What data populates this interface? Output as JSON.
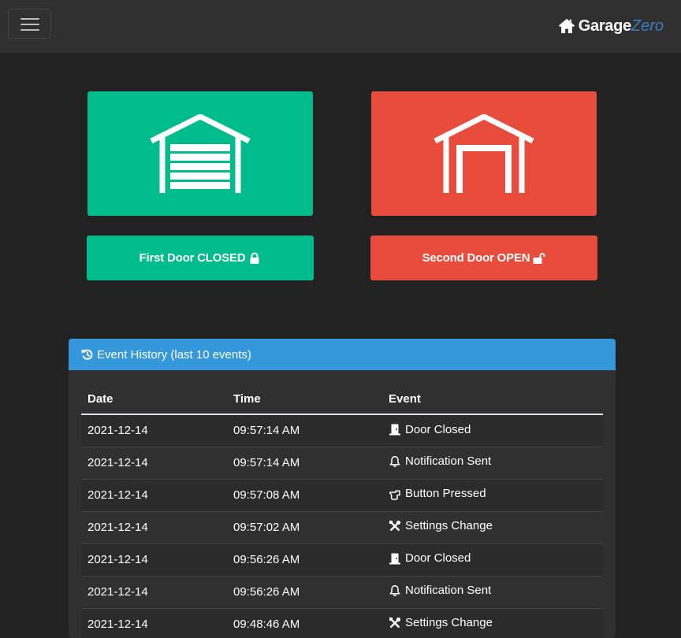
{
  "navbar": {
    "toggle_icon": "hamburger-menu-icon",
    "brand_icon": "home-icon",
    "brand_part1": "Garage",
    "brand_part2": "Zero",
    "brand_accent_color": "#3a7bc0"
  },
  "doors": [
    {
      "status": "CLOSED",
      "button_label": "First Door CLOSED",
      "card_icon": "garage-closed-icon",
      "status_icon": "lock-icon",
      "color": "#00bc8c"
    },
    {
      "status": "OPEN",
      "button_label": "Second Door OPEN",
      "card_icon": "garage-open-icon",
      "status_icon": "unlock-icon",
      "color": "#e74c3c"
    }
  ],
  "history": {
    "title": "Event History (last 10 events)",
    "title_icon": "history-icon",
    "header_color": "#3498db",
    "columns": [
      "Date",
      "Time",
      "Event"
    ],
    "rows": [
      {
        "date": "2021-12-14",
        "time": "09:57:14 AM",
        "event": "Door Closed",
        "icon": "door-closed-icon"
      },
      {
        "date": "2021-12-14",
        "time": "09:57:14 AM",
        "event": "Notification Sent",
        "icon": "bell-icon"
      },
      {
        "date": "2021-12-14",
        "time": "09:57:08 AM",
        "event": "Button Pressed",
        "icon": "hand-pointer-icon"
      },
      {
        "date": "2021-12-14",
        "time": "09:57:02 AM",
        "event": "Settings Change",
        "icon": "tools-icon"
      },
      {
        "date": "2021-12-14",
        "time": "09:56:26 AM",
        "event": "Door Closed",
        "icon": "door-closed-icon"
      },
      {
        "date": "2021-12-14",
        "time": "09:56:26 AM",
        "event": "Notification Sent",
        "icon": "bell-icon"
      },
      {
        "date": "2021-12-14",
        "time": "09:48:46 AM",
        "event": "Settings Change",
        "icon": "tools-icon"
      }
    ]
  }
}
